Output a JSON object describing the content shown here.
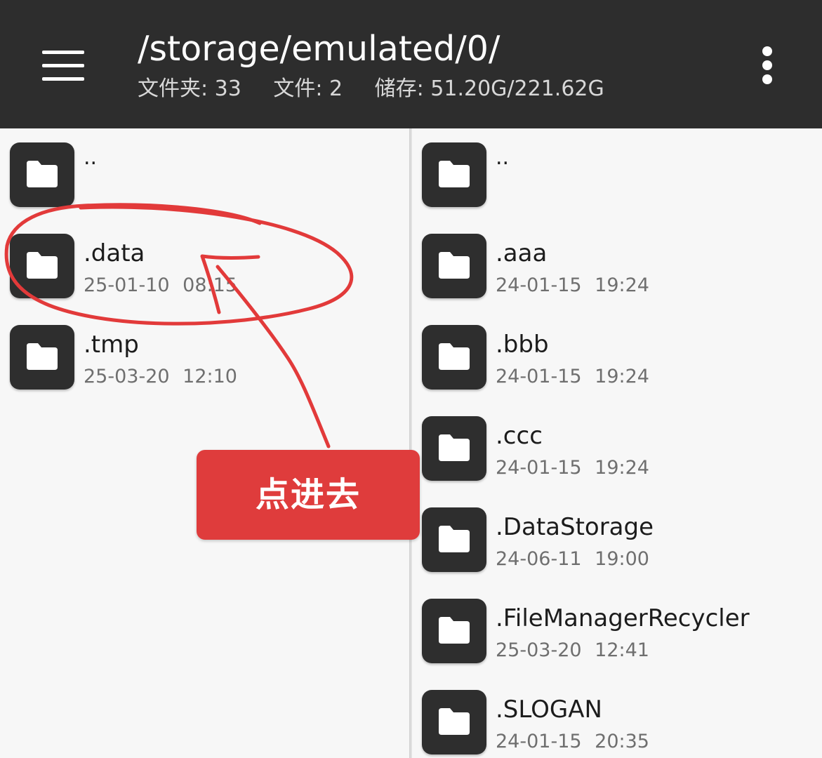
{
  "toolbar": {
    "path": "/storage/emulated/0/",
    "folders_stat": "文件夹: 33",
    "files_stat": "文件: 2",
    "storage_stat": "储存: 51.20G/221.62G"
  },
  "left_pane": {
    "items": [
      {
        "name": "..",
        "date": ""
      },
      {
        "name": ".data",
        "date": "25-01-10 08:15"
      },
      {
        "name": ".tmp",
        "date": "25-03-20 12:10"
      }
    ]
  },
  "right_pane": {
    "items": [
      {
        "name": "..",
        "date": ""
      },
      {
        "name": ".aaa",
        "date": "24-01-15 19:24"
      },
      {
        "name": ".bbb",
        "date": "24-01-15 19:24"
      },
      {
        "name": ".ccc",
        "date": "24-01-15 19:24"
      },
      {
        "name": ".DataStorage",
        "date": "24-06-11 19:00"
      },
      {
        "name": ".FileManagerRecycler",
        "date": "25-03-20 12:41"
      },
      {
        "name": ".SLOGAN",
        "date": "24-01-15 20:35"
      }
    ]
  },
  "annotation": {
    "callout_text": "点进去",
    "color": "#df3c3c"
  },
  "colors": {
    "toolbar_bg": "#2d2d2d",
    "folder_tile": "#2e2e2e",
    "pane_bg": "#f7f7f7"
  }
}
